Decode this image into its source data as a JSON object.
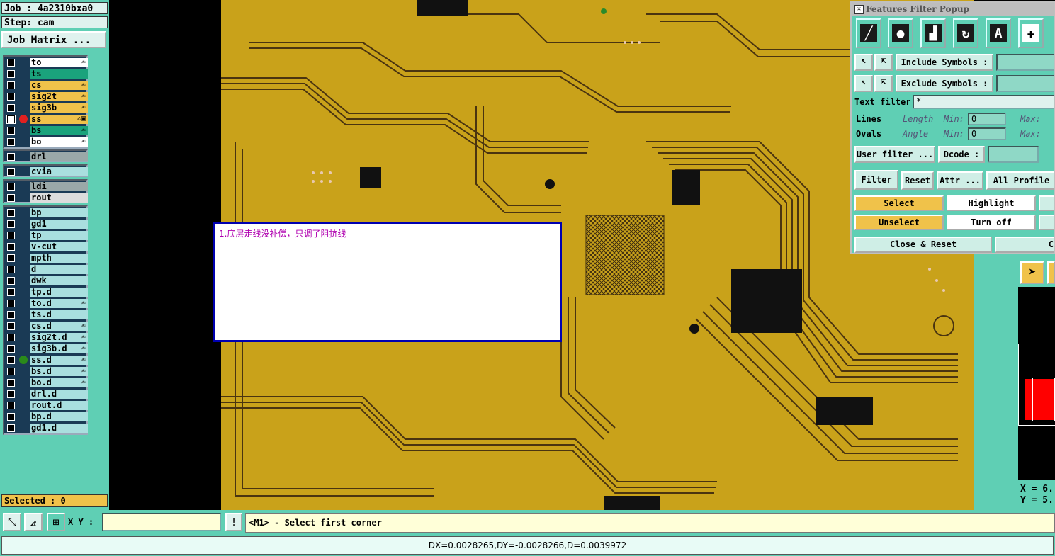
{
  "header": {
    "job": "Job : 4a2310bxa0",
    "step": "Step: cam",
    "job_matrix": "Job Matrix ..."
  },
  "layers_group1": [
    {
      "name": "to",
      "color": "#ffffff",
      "flag": "✍"
    },
    {
      "name": "ts",
      "color": "#1aa37c",
      "flag": ""
    },
    {
      "name": "cs",
      "color": "#f0c24a",
      "flag": "✍"
    },
    {
      "name": "sig2t",
      "color": "#f0c24a",
      "flag": "✍"
    },
    {
      "name": "sig3b",
      "color": "#f0c24a",
      "flag": "✍"
    },
    {
      "name": "ss",
      "color": "#f0c24a",
      "flag": "✍▣",
      "active": true,
      "dot": "#e02020"
    },
    {
      "name": "bs",
      "color": "#1aa37c",
      "flag": "✍"
    },
    {
      "name": "bo",
      "color": "#ffffff",
      "flag": "✍"
    }
  ],
  "layers_drl": [
    {
      "name": "drl",
      "color": "#9aa8a8"
    }
  ],
  "layers_cvia": [
    {
      "name": "cvia",
      "color": "#a9dfdf"
    }
  ],
  "layers_misc": [
    {
      "name": "ldi",
      "color": "#9aa8a8"
    },
    {
      "name": "rout",
      "color": "#dcdcdc"
    }
  ],
  "layers_doc": [
    {
      "name": "bp",
      "color": "#a9dfdf",
      "flag": ""
    },
    {
      "name": "gd1",
      "color": "#a9dfdf",
      "flag": ""
    },
    {
      "name": "tp",
      "color": "#a9dfdf",
      "flag": ""
    },
    {
      "name": "v-cut",
      "color": "#a9dfdf",
      "flag": ""
    },
    {
      "name": "mpth",
      "color": "#a9dfdf",
      "flag": ""
    },
    {
      "name": "d",
      "color": "#a9dfdf",
      "flag": ""
    },
    {
      "name": "dwk",
      "color": "#a9dfdf",
      "flag": ""
    },
    {
      "name": "tp.d",
      "color": "#a9dfdf",
      "flag": ""
    },
    {
      "name": "to.d",
      "color": "#a9dfdf",
      "flag": "✍"
    },
    {
      "name": "ts.d",
      "color": "#a9dfdf",
      "flag": ""
    },
    {
      "name": "cs.d",
      "color": "#a9dfdf",
      "flag": "✍"
    },
    {
      "name": "sig2t.d",
      "color": "#a9dfdf",
      "flag": "✍"
    },
    {
      "name": "sig3b.d",
      "color": "#a9dfdf",
      "flag": "✍"
    },
    {
      "name": "ss.d",
      "color": "#a9dfdf",
      "flag": "✍",
      "dot": "#2a8a1a"
    },
    {
      "name": "bs.d",
      "color": "#a9dfdf",
      "flag": "✍"
    },
    {
      "name": "bo.d",
      "color": "#a9dfdf",
      "flag": "✍"
    },
    {
      "name": "drl.d",
      "color": "#a9dfdf",
      "flag": ""
    },
    {
      "name": "rout.d",
      "color": "#a9dfdf",
      "flag": ""
    },
    {
      "name": "bp.d",
      "color": "#a9dfdf",
      "flag": ""
    },
    {
      "name": "gd1.d",
      "color": "#a9dfdf",
      "flag": ""
    }
  ],
  "selected": "Selected : 0",
  "note": {
    "text": "1.底层走线没补偿，只调了阻抗线"
  },
  "filter_popup": {
    "title": "Features Filter Popup",
    "include_symbols": "Include Symbols :",
    "exclude_symbols": "Exclude Symbols :",
    "text_filter_label": "Text filter",
    "text_filter_value": "*",
    "lines": "Lines",
    "ovals": "Ovals",
    "length": "Length",
    "angle": "Angle",
    "min1": "Min:",
    "min2": "Min:",
    "min1_value": "0",
    "min2_value": "0",
    "max1": "Max:",
    "max2": "Max:",
    "user_filter": "User filter ...",
    "dcode": "Dcode :",
    "filter": "Filter",
    "reset": "Reset",
    "attr": "Attr ...",
    "all_profile": "All Profile",
    "select": "Select",
    "highlight": "Highlight",
    "unselect": "Unselect",
    "turn_off": "Turn off",
    "close_reset": "Close & Reset",
    "close_short": "C"
  },
  "coords": {
    "x": "X = 6.",
    "y": "Y = 5."
  },
  "bottom": {
    "xy_label": "X Y :",
    "prompt": "<M1> - Select first corner",
    "status": "DX=0.0028265,DY=-0.0028266,D=0.0039972"
  }
}
